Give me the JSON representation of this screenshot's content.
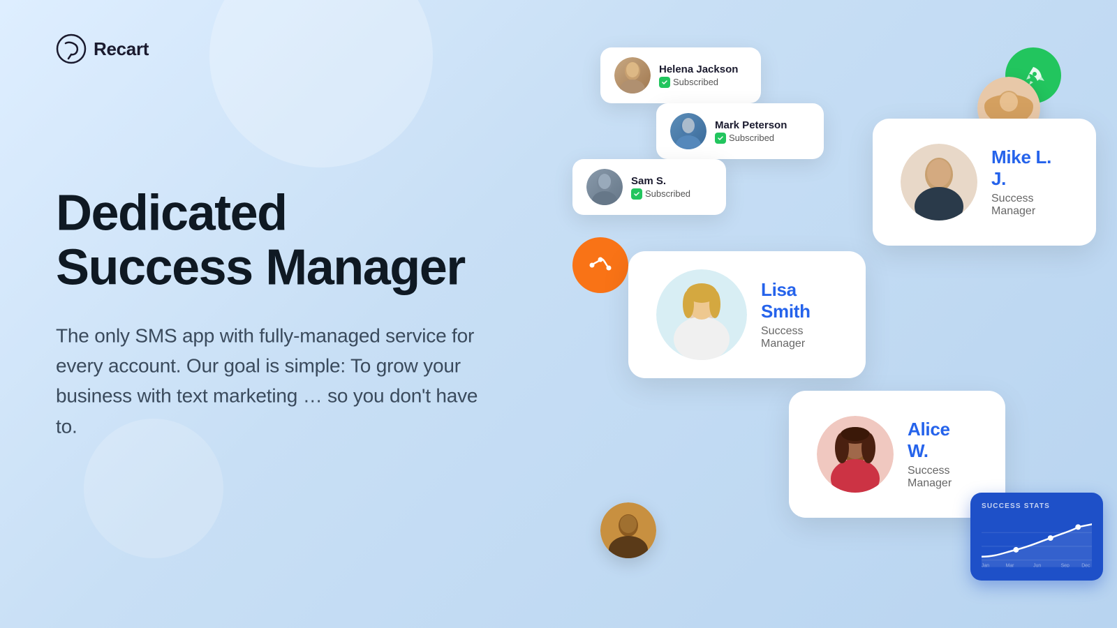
{
  "logo": {
    "name": "Recart",
    "icon": "R"
  },
  "heading": {
    "line1": "Dedicated",
    "line2": "Success Manager"
  },
  "subtext": "The only SMS app with fully-managed service for every account. Our goal is simple: To grow your business with text marketing … so you don't have to.",
  "subscribers": [
    {
      "name": "Helena Jackson",
      "status": "Subscribed"
    },
    {
      "name": "Mark Peterson",
      "status": "Subscribed"
    },
    {
      "name": "Sam S.",
      "status": "Subscribed"
    }
  ],
  "managers": [
    {
      "name": "Mike L. J.",
      "title": "Success Manager"
    },
    {
      "name": "Lisa Smith",
      "title": "Success Manager"
    },
    {
      "name": "Alice W.",
      "title": "Success Manager"
    }
  ],
  "stats_card": {
    "title": "SUCCESS STATS"
  }
}
